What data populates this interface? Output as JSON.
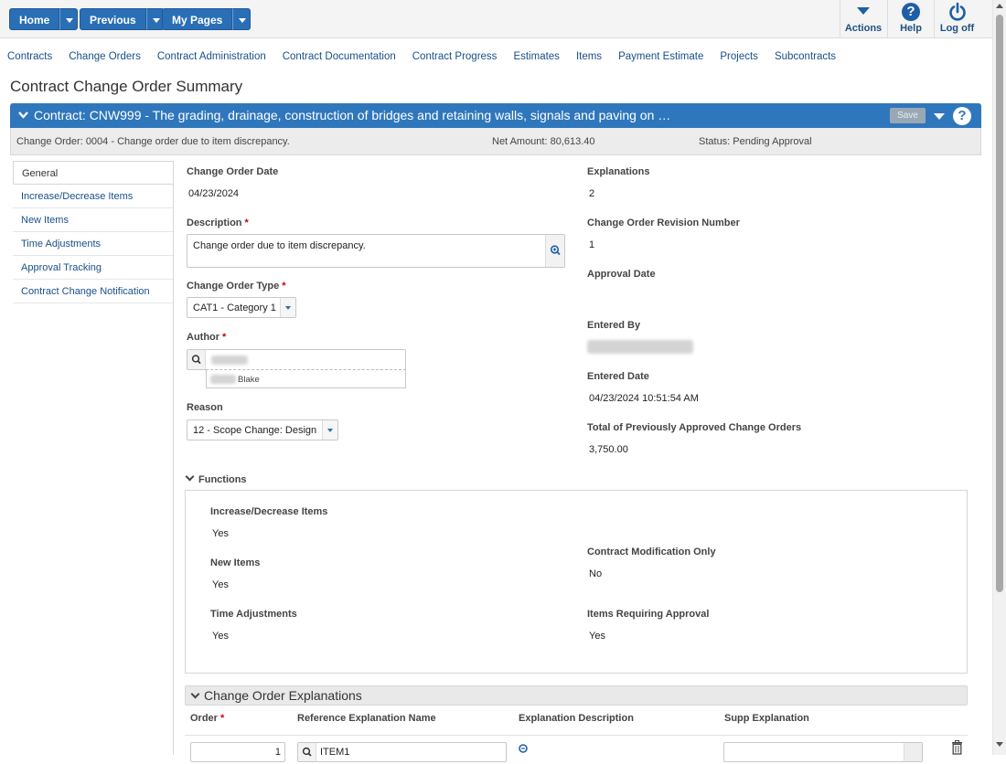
{
  "toolbar": {
    "home_label": "Home",
    "previous_label": "Previous",
    "mypages_label": "My Pages",
    "actions_label": "Actions",
    "help_label": "Help",
    "logoff_label": "Log off"
  },
  "nav_links": [
    "Contracts",
    "Change Orders",
    "Contract Administration",
    "Contract Documentation",
    "Contract Progress",
    "Estimates",
    "Items",
    "Payment Estimate",
    "Projects",
    "Subcontracts"
  ],
  "page_title": "Contract Change Order Summary",
  "contract_bar": {
    "title": "Contract: CNW999 - The grading, drainage, construction of bridges and retaining walls, signals and paving on …",
    "save_label": "Save",
    "help_glyph": "?"
  },
  "info_bar": {
    "change_order": "Change Order: 0004 - Change order due to item discrepancy.",
    "net_amount": "Net Amount: 80,613.40",
    "status": "Status: Pending Approval"
  },
  "side_tabs": [
    "General",
    "Increase/Decrease Items",
    "New Items",
    "Time Adjustments",
    "Approval Tracking",
    "Contract Change Notification"
  ],
  "form": {
    "change_order_date_label": "Change Order Date",
    "change_order_date": "04/23/2024",
    "description_label": "Description",
    "description": "Change order due to item discrepancy.",
    "change_order_type_label": "Change Order Type",
    "change_order_type": "CAT1 - Category 1",
    "author_label": "Author",
    "author_suggestion": "Blake",
    "reason_label": "Reason",
    "reason": "12 - Scope Change: Design",
    "explanations_label": "Explanations",
    "explanations": "2",
    "revision_label": "Change Order Revision Number",
    "revision": "1",
    "approval_date_label": "Approval Date",
    "entered_by_label": "Entered By",
    "entered_date_label": "Entered Date",
    "entered_date": "04/23/2024 10:51:54 AM",
    "prev_approved_label": "Total of Previously Approved Change Orders",
    "prev_approved": "3,750.00",
    "required_mark": "*"
  },
  "functions": {
    "heading": "Functions",
    "inc_dec_label": "Increase/Decrease Items",
    "inc_dec": "Yes",
    "new_items_label": "New Items",
    "new_items": "Yes",
    "time_adj_label": "Time Adjustments",
    "time_adj": "Yes",
    "contract_mod_label": "Contract Modification Only",
    "contract_mod": "No",
    "items_req_label": "Items Requiring Approval",
    "items_req": "Yes"
  },
  "explanations_section": {
    "heading": "Change Order Explanations",
    "col_order": "Order",
    "col_ref": "Reference Explanation Name",
    "col_desc": "Explanation Description",
    "col_supp": "Supp Explanation",
    "row1_order": "1",
    "row1_ref": "ITEM1"
  },
  "colors": {
    "primary": "#2a6fb5",
    "header_bar": "#2f77bd",
    "link": "#1a4f8a",
    "required": "#cc0000"
  }
}
